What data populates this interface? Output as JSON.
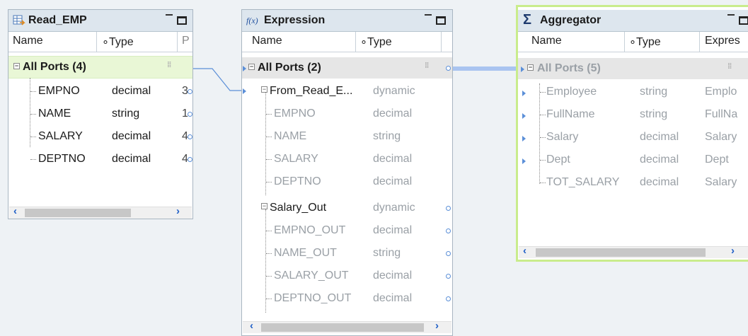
{
  "panels": {
    "read_emp": {
      "title": "Read_EMP",
      "col_name": "Name",
      "col_type": "Type",
      "col_third": "P",
      "group_label": "All Ports (4)",
      "rows": [
        {
          "name": "EMPNO",
          "type": "decimal",
          "third": "3"
        },
        {
          "name": "NAME",
          "type": "string",
          "third": "1"
        },
        {
          "name": "SALARY",
          "type": "decimal",
          "third": "4"
        },
        {
          "name": "DEPTNO",
          "type": "decimal",
          "third": "4"
        }
      ]
    },
    "expression": {
      "title": "Expression",
      "icon_label": "f(x)",
      "col_name": "Name",
      "col_type": "Type",
      "group_label": "All Ports (2)",
      "sub_groups": [
        {
          "name": "From_Read_E...",
          "type": "dynamic",
          "rows": [
            {
              "name": "EMPNO",
              "type": "decimal"
            },
            {
              "name": "NAME",
              "type": "string"
            },
            {
              "name": "SALARY",
              "type": "decimal"
            },
            {
              "name": "DEPTNO",
              "type": "decimal"
            }
          ]
        },
        {
          "name": "Salary_Out",
          "type": "dynamic",
          "rows": [
            {
              "name": "EMPNO_OUT",
              "type": "decimal"
            },
            {
              "name": "NAME_OUT",
              "type": "string"
            },
            {
              "name": "SALARY_OUT",
              "type": "decimal"
            },
            {
              "name": "DEPTNO_OUT",
              "type": "decimal"
            }
          ]
        }
      ]
    },
    "aggregator": {
      "title": "Aggregator",
      "icon_label": "Σ",
      "col_name": "Name",
      "col_type": "Type",
      "col_expr": "Expres",
      "group_label": "All Ports (5)",
      "rows": [
        {
          "name": "Employee",
          "type": "string",
          "expr": "Emplo"
        },
        {
          "name": "FullName",
          "type": "string",
          "expr": "FullNa"
        },
        {
          "name": "Salary",
          "type": "decimal",
          "expr": "Salary"
        },
        {
          "name": "Dept",
          "type": "decimal",
          "expr": "Dept"
        },
        {
          "name": "TOT_SALARY",
          "type": "decimal",
          "expr": "Salary"
        }
      ]
    }
  },
  "colors": {
    "canvas": "#eef2f5",
    "titlebar": "#dde6ee",
    "selected_border": "#c9ec8c",
    "group_highlight": "#e9f7d6",
    "link": "#5b8fd8",
    "link_band": "#a9c4f0"
  },
  "icons": {
    "read_emp": "table-source-icon",
    "expression": "function-icon",
    "aggregator": "sigma-icon"
  }
}
